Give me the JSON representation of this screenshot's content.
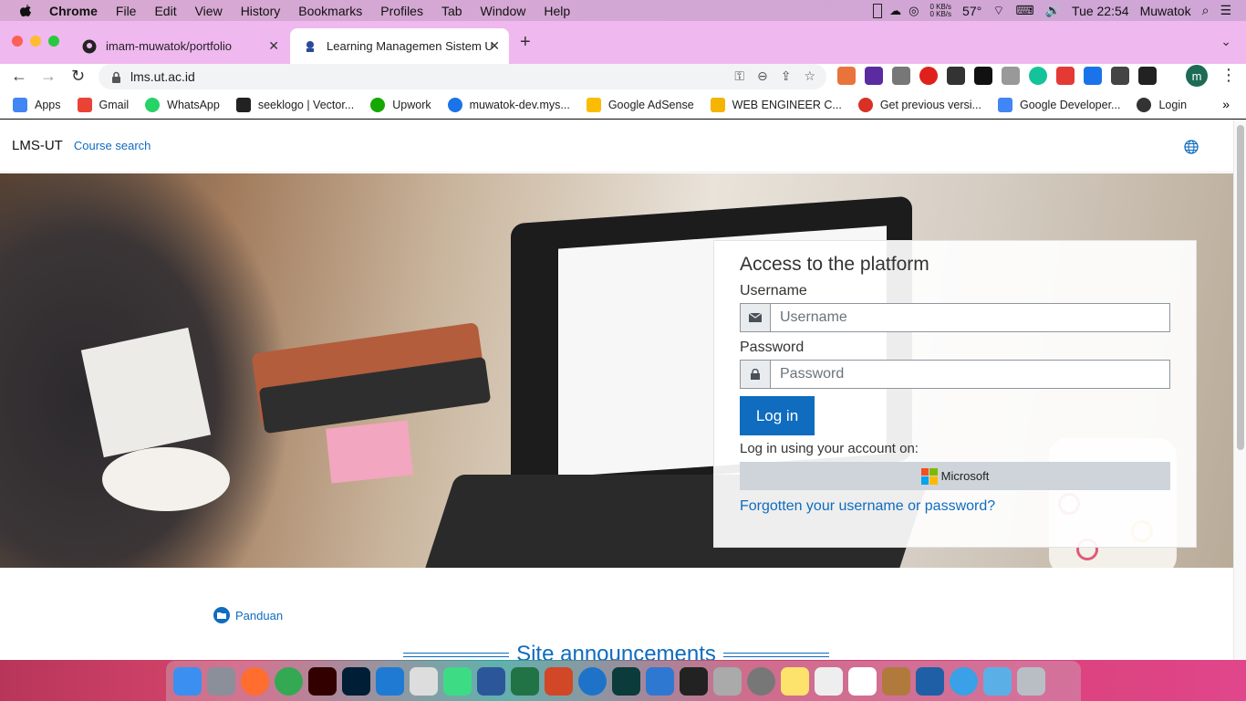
{
  "menubar": {
    "app": "Chrome",
    "items": [
      "File",
      "Edit",
      "View",
      "History",
      "Bookmarks",
      "Profiles",
      "Tab",
      "Window",
      "Help"
    ],
    "net_up": "0 KB/s",
    "net_down": "0 KB/s",
    "temp": "57°",
    "clock": "Tue 22:54",
    "user": "Muwatok"
  },
  "tabs": [
    {
      "title": "imam-muwatok/portfolio"
    },
    {
      "title": "Learning Managemen Sistem U"
    }
  ],
  "omnibox": {
    "url": "lms.ut.ac.id"
  },
  "profile_initial": "m",
  "bookmarks": [
    {
      "label": "Apps",
      "color": "#4285f4"
    },
    {
      "label": "Gmail",
      "color": "#ea4335"
    },
    {
      "label": "WhatsApp",
      "color": "#25d366"
    },
    {
      "label": "seeklogo | Vector...",
      "color": "#222222"
    },
    {
      "label": "Upwork",
      "color": "#14a800"
    },
    {
      "label": "muwatok-dev.mys...",
      "color": "#1a73e8"
    },
    {
      "label": "Google AdSense",
      "color": "#fbbc04"
    },
    {
      "label": "WEB ENGINEER C...",
      "color": "#f4b400"
    },
    {
      "label": "Get previous versi...",
      "color": "#d93025"
    },
    {
      "label": "Google Developer...",
      "color": "#4285f4"
    },
    {
      "label": "Login",
      "color": "#333333"
    }
  ],
  "lms": {
    "brand": "LMS-UT",
    "course_search": "Course search",
    "login_title": "Access to the platform",
    "username_label": "Username",
    "username_placeholder": "Username",
    "password_label": "Password",
    "password_placeholder": "Password",
    "login_button": "Log in",
    "login_using": "Log in using your account on:",
    "microsoft_button": "Microsoft",
    "forgot": "Forgotten your username or password?",
    "panduan": "Panduan",
    "site_announcements": "Site announcements"
  },
  "colors": {
    "accent": "#0f6cbf",
    "tabstrip": "#efb8ee"
  }
}
